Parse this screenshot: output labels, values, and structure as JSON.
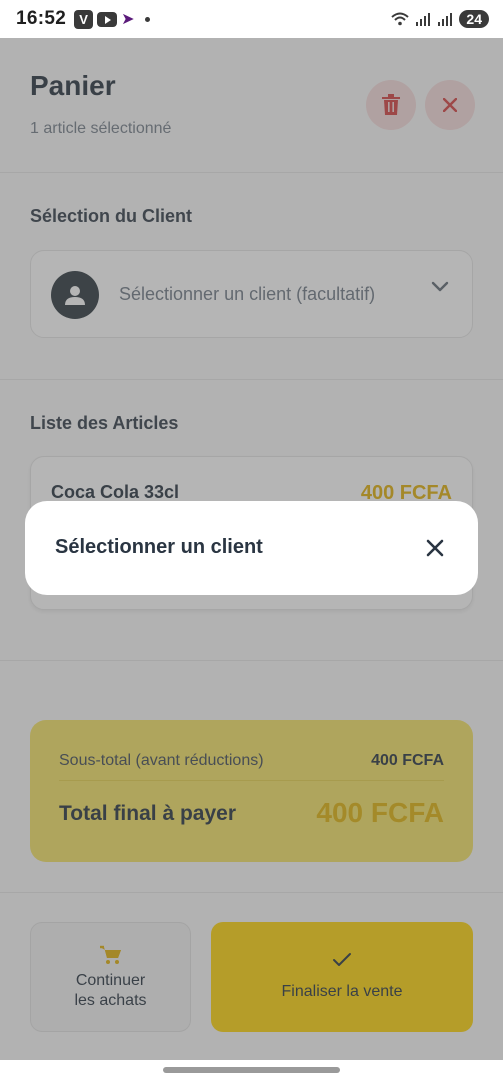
{
  "status_bar": {
    "time": "16:52",
    "app_icon_v": "V",
    "battery": "24"
  },
  "header": {
    "title": "Panier",
    "subtitle": "1 article sélectionné"
  },
  "client_section": {
    "title": "Sélection du Client",
    "placeholder": "Sélectionner un client (facultatif)"
  },
  "articles_section": {
    "title": "Liste des Articles",
    "items": [
      {
        "name": "Coca Cola 33cl",
        "price": "400 FCFA"
      }
    ]
  },
  "totals": {
    "subtotal_label": "Sous-total (avant réductions)",
    "subtotal_value": "400 FCFA",
    "final_label": "Total final à payer",
    "final_value": "400 FCFA"
  },
  "actions": {
    "continue_label_line1": "Continuer",
    "continue_label_line2": "les achats",
    "finalize_label": "Finaliser la vente"
  },
  "modal": {
    "title": "Sélectionner un client"
  },
  "icons": {
    "delete": "trash-icon",
    "close": "close-icon",
    "avatar": "person-icon",
    "chevron": "chevron-down-icon",
    "cart": "cart-icon",
    "check": "check-icon"
  },
  "colors": {
    "accent_yellow": "#ffd400",
    "price_gold": "#e0ad00",
    "danger_red": "#d33a3a"
  }
}
